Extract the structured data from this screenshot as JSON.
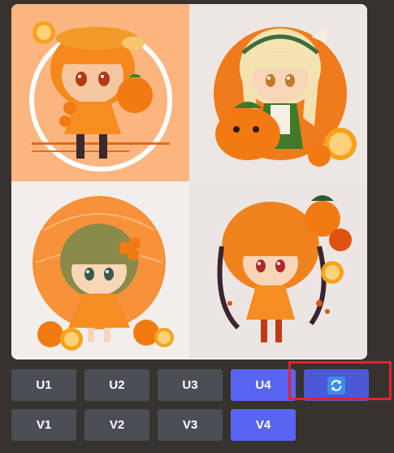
{
  "image_grid": {
    "tiles": [
      {
        "subject": "chibi girl with orange hair holding an orange"
      },
      {
        "subject": "chibi blonde girl with oranges"
      },
      {
        "subject": "chibi girl with green hair and orange slices"
      },
      {
        "subject": "chibi girl with orange hair and orange on head"
      }
    ]
  },
  "buttons": {
    "upscale": [
      "U1",
      "U2",
      "U3",
      "U4"
    ],
    "variation": [
      "V1",
      "V2",
      "V3",
      "V4"
    ],
    "reroll_icon": "reroll-icon",
    "active_upscale": "U4",
    "active_variation": "V4"
  },
  "colors": {
    "button_gray": "#4b4e54",
    "button_blue": "#5865f2",
    "highlight": "#e8202f",
    "background": "#36332f"
  }
}
